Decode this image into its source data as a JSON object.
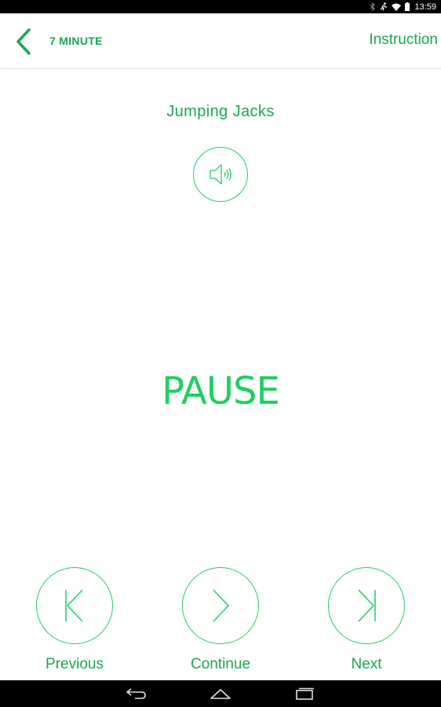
{
  "status_bar": {
    "time": "13:59",
    "icons": [
      "bluetooth-icon",
      "running-person-icon",
      "wifi-icon",
      "battery-icon"
    ]
  },
  "app_bar": {
    "title": "7 MINUTE",
    "instruction_label": "Instruction",
    "back_icon": "chevron-left-icon"
  },
  "exercise": {
    "name": "Jumping Jacks",
    "sound_icon": "speaker-icon"
  },
  "state": {
    "label": "PAUSE"
  },
  "controls": {
    "previous_label": "Previous",
    "continue_label": "Continue",
    "next_label": "Next"
  },
  "nav_bar": {
    "icons": [
      "back-icon",
      "home-icon",
      "recents-icon"
    ]
  },
  "colors": {
    "accent": "#1aa652",
    "accent_light": "#1fcf62",
    "bar_background": "#000000",
    "divider": "#dedede"
  }
}
